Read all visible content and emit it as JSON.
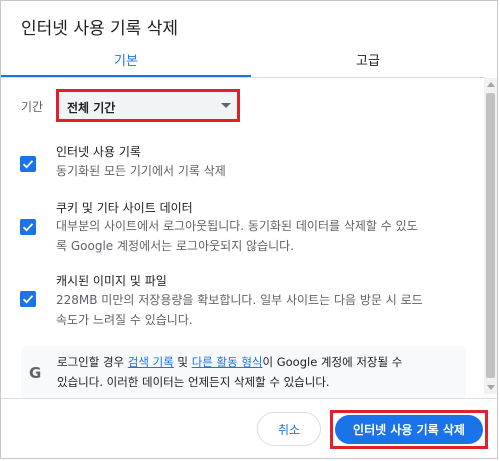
{
  "dialog": {
    "title": "인터넷 사용 기록 삭제"
  },
  "tabs": [
    {
      "label": "기본",
      "active": true
    },
    {
      "label": "고급",
      "active": false
    }
  ],
  "time_range": {
    "label": "기간",
    "selected": "전체 기간"
  },
  "options": [
    {
      "title": "인터넷 사용 기록",
      "desc_lines": [
        "동기화된 모든 기기에서 기록 삭제"
      ],
      "checked": true
    },
    {
      "title": "쿠키 및 기타 사이트 데이터",
      "desc_lines": [
        "대부분의 사이트에서 로그아웃됩니다. 동기화된 데이터를 삭제할 수 있도",
        "록 Google 계정에서는 로그아웃되지 않습니다."
      ],
      "checked": true
    },
    {
      "title": "캐시된 이미지 및 파일",
      "desc_lines": [
        "228MB 미만의 저장용량을 확보합니다. 일부 사이트는 다음 방문 시 로드",
        "속도가 느려질 수 있습니다."
      ],
      "checked": true
    }
  ],
  "info": {
    "icon": "G",
    "text_prefix": "로그인할 경우 ",
    "link1": "검색 기록",
    "text_mid": " 및 ",
    "link2": "다른 활동 형식",
    "text_suffix": "이 Google 계정에 저장될 수",
    "line2": "있습니다. 이러한 데이터는 언제든지 삭제할 수 있습니다."
  },
  "footer": {
    "cancel_label": "취소",
    "delete_label": "인터넷 사용 기록 삭제"
  },
  "colors": {
    "accent": "#1a73e8",
    "highlight": "#e0202a"
  }
}
